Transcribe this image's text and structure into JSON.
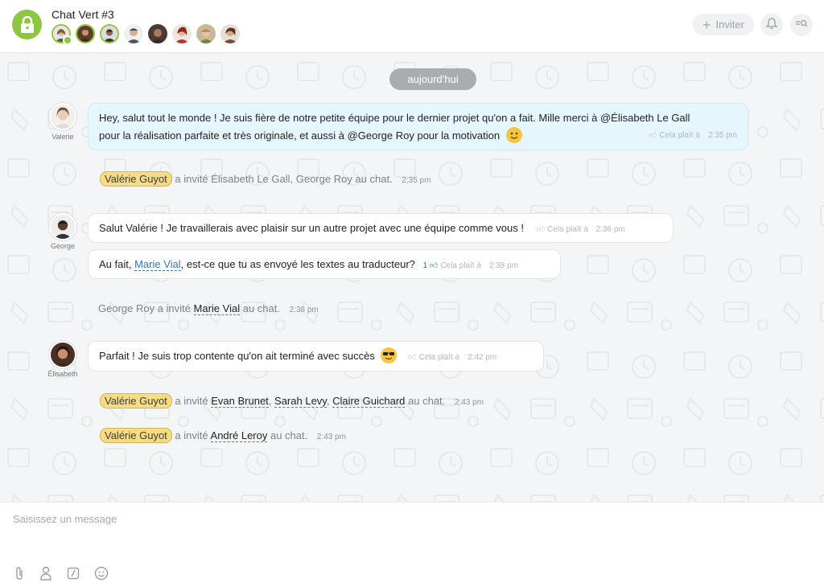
{
  "header": {
    "title": "Chat Vert #3",
    "invite_label": "Inviter",
    "members": [
      "avatar-1",
      "avatar-2",
      "avatar-3",
      "avatar-4",
      "avatar-5",
      "avatar-6",
      "avatar-7",
      "avatar-8"
    ]
  },
  "chat": {
    "date_label": "aujourd'hui",
    "messages": [
      {
        "author": "Valerie",
        "line1": "Hey, salut tout le monde ! Je suis fière de notre petite équipe pour le dernier projet qu'on a fait. Mille merci à @Élisabeth Le Gall",
        "line2": "pour la réalisation parfaite et très originale, et aussi à @George Roy pour la motivation",
        "like_label": "Cela plaît à",
        "time": "2:35 pm"
      },
      {
        "author": "George",
        "text": "Salut Valérie ! Je travaillerais avec plaisir sur un autre projet avec une équipe comme vous !",
        "like_label": "Cela plaît à",
        "time": "2:36 pm"
      },
      {
        "text_before": "Au fait,",
        "mention": "Marie Vial",
        "text_after": ", est-ce que tu as envoyé les textes au traducteur?",
        "like_count": "1",
        "like_label": "Cela plaît à",
        "time": "2:38 pm"
      },
      {
        "author": "Élisabeth",
        "text": "Parfait ! Je suis trop contente qu'on ait terminé avec succès",
        "like_label": "Cela plaît à",
        "time": "2:42 pm"
      }
    ],
    "system": [
      {
        "actor": "Valérie Guyot",
        "text": "a invité Élisabeth Le Gall, George Roy au chat.",
        "time": "2:35 pm"
      },
      {
        "text_before": "George Roy a invité",
        "name": "Marie Vial",
        "text_after": "au chat.",
        "time": "2:38 pm"
      },
      {
        "actor": "Valérie Guyot",
        "text_before": "a invité",
        "names": [
          "Evan Brunet",
          "Sarah Levy",
          "Claire Guichard"
        ],
        "text_after": "au chat.",
        "time": "2:43 pm"
      },
      {
        "actor": "Valérie Guyot",
        "text_before": "a invité",
        "name": "André Leroy",
        "text_after": "au chat.",
        "time": "2:43 pm"
      }
    ]
  },
  "composer": {
    "placeholder": "Saisissez un message",
    "tools": [
      "paperclip-icon",
      "person-icon",
      "slash-command-icon",
      "smiley-icon"
    ]
  },
  "colors": {
    "brand_green": "#8dc63f",
    "mine_bubble": "#e6f6fd",
    "mention_tag": "#f8dc82",
    "link_blue": "#3a75b0"
  }
}
